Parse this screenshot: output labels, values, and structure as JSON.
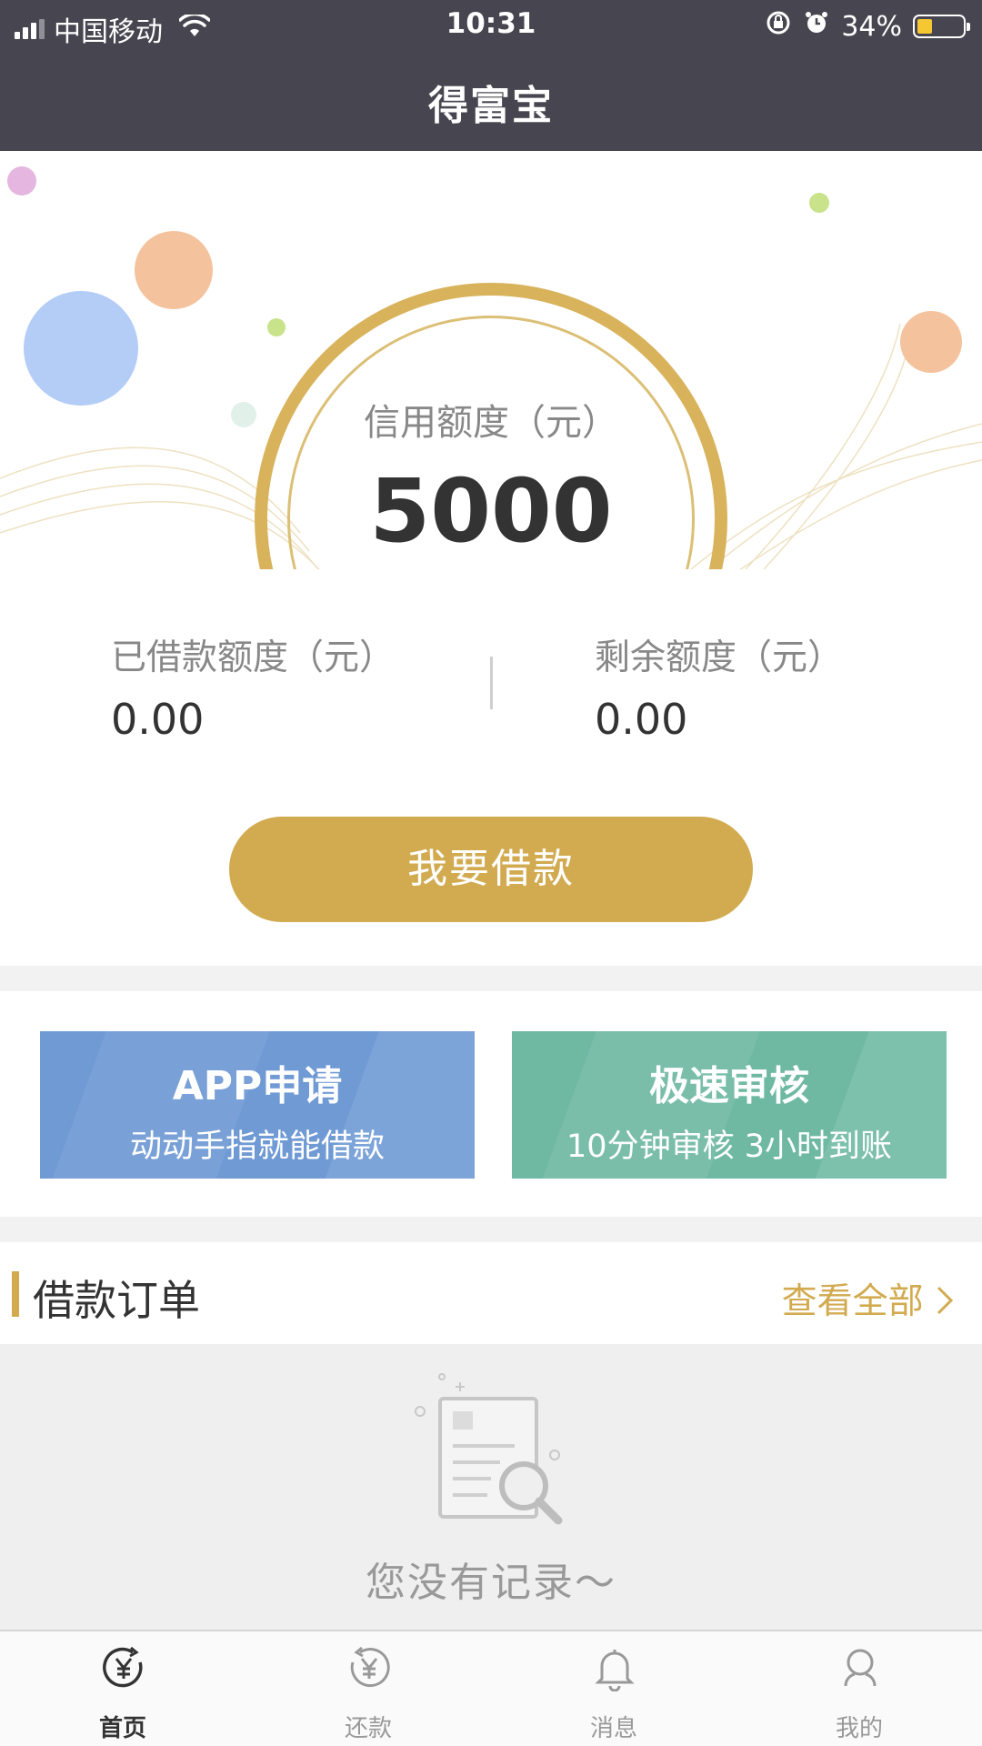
{
  "status_bar": {
    "carrier": "中国移动",
    "time": "10:31",
    "battery": "34%",
    "battery_level": 0.34
  },
  "nav": {
    "title": "得富宝"
  },
  "hero": {
    "credit_label": "信用额度（元）",
    "credit_value": "5000"
  },
  "stats": {
    "borrowed_label": "已借款额度（元）",
    "borrowed_value": "0.00",
    "remaining_label": "剩余额度（元）",
    "remaining_value": "0.00"
  },
  "borrow_button": {
    "label": "我要借款"
  },
  "cards": [
    {
      "title": "APP申请",
      "subtitle": "动动手指就能借款",
      "color": "#6f9ad4"
    },
    {
      "title": "极速审核",
      "subtitle": "10分钟审核 3小时到账",
      "color": "#6fb9a3"
    }
  ],
  "orders": {
    "title": "借款订单",
    "view_all": "查看全部",
    "empty_text": "您没有记录～"
  },
  "tabbar": {
    "items": [
      {
        "label": "首页",
        "icon": "yen-home-icon",
        "active": true
      },
      {
        "label": "还款",
        "icon": "yen-return-icon",
        "active": false
      },
      {
        "label": "消息",
        "icon": "bell-icon",
        "active": false
      },
      {
        "label": "我的",
        "icon": "user-icon",
        "active": false
      }
    ]
  },
  "colors": {
    "accent": "#d2ab51",
    "nav_bg": "#47454f",
    "card_blue": "#6f9ad4",
    "card_green": "#6fb9a3"
  }
}
